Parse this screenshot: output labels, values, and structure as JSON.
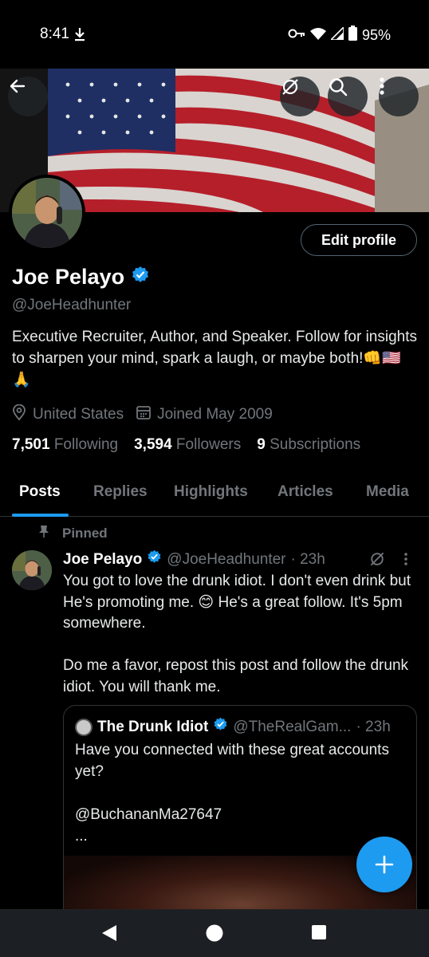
{
  "status": {
    "time": "8:41",
    "battery": "95%"
  },
  "profile": {
    "name": "Joe Pelayo",
    "handle": "@JoeHeadhunter",
    "bio": "Executive Recruiter, Author, and Speaker. Follow for insights to sharpen your mind, spark a laugh, or maybe both!👊🇺🇸🙏",
    "location": "United States",
    "joined": "Joined May 2009",
    "edit_label": "Edit profile",
    "stats": [
      {
        "value": "7,501",
        "label": "Following"
      },
      {
        "value": "3,594",
        "label": "Followers"
      },
      {
        "value": "9",
        "label": "Subscriptions"
      }
    ]
  },
  "tabs": [
    "Posts",
    "Replies",
    "Highlights",
    "Articles",
    "Media"
  ],
  "post": {
    "pinned_label": "Pinned",
    "name": "Joe Pelayo",
    "handle": "@JoeHeadhunter",
    "time": "· 23h",
    "text": "You got to love the drunk idiot. I don't even drink but He's promoting me. 😊 He's a great follow. It's 5pm somewhere.\n\nDo me a favor, repost this post and follow the drunk idiot. You will thank me."
  },
  "quote": {
    "name": "The Drunk Idiot",
    "handle": "@TheRealGam...",
    "time": "· 23h",
    "text": "Have you connected with these great accounts yet?\n\n@BuchananMa27647\n..."
  },
  "colors": {
    "accent": "#1d9bf0",
    "background": "#000000",
    "secondary_text": "#71767b"
  }
}
